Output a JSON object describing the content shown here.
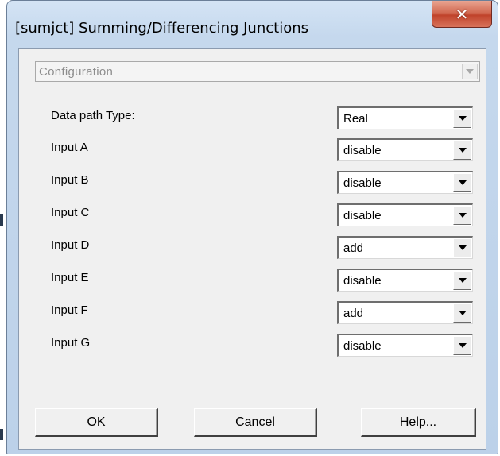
{
  "window": {
    "title": "[sumjct] Summing/Differencing Junctions",
    "close_icon": "close-icon"
  },
  "configuration": {
    "label": "Configuration",
    "disabled": true
  },
  "fields": [
    {
      "label": "Data path Type:",
      "value": "Real"
    },
    {
      "label": "Input A",
      "value": "disable"
    },
    {
      "label": "Input B",
      "value": "disable"
    },
    {
      "label": "Input C",
      "value": "disable"
    },
    {
      "label": "Input D",
      "value": "add"
    },
    {
      "label": "Input E",
      "value": "disable"
    },
    {
      "label": "Input F",
      "value": "add"
    },
    {
      "label": "Input G",
      "value": "disable"
    }
  ],
  "buttons": {
    "ok": "OK",
    "cancel": "Cancel",
    "help": "Help..."
  },
  "colors": {
    "close_button": "#c8472f",
    "window_frame": "#c5d8ed",
    "client_background": "#f0f0f0"
  }
}
